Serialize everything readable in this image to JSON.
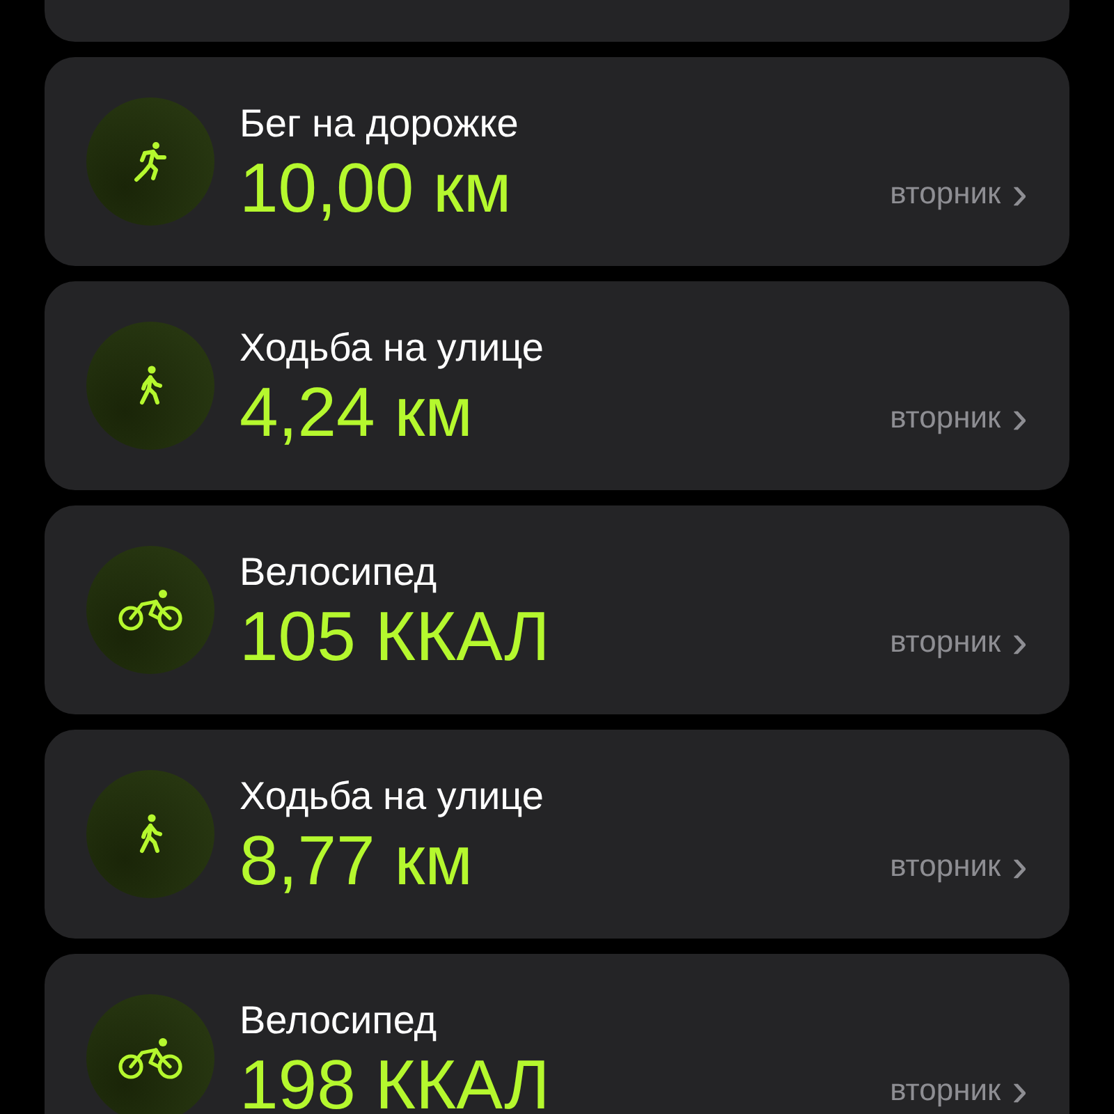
{
  "workouts": [
    {
      "kind": "run",
      "title": "Бег на дорожке",
      "value": "10,00 км",
      "day": "вторник",
      "chevron": "›"
    },
    {
      "kind": "walk",
      "title": "Ходьба на улице",
      "value": "4,24 км",
      "day": "вторник",
      "chevron": "›"
    },
    {
      "kind": "bike",
      "title": "Велосипед",
      "value": "105 ККАЛ",
      "day": "вторник",
      "chevron": "›"
    },
    {
      "kind": "walk",
      "title": "Ходьба на улице",
      "value": "8,77 км",
      "day": "вторник",
      "chevron": "›"
    },
    {
      "kind": "bike",
      "title": "Велосипед",
      "value": "198 ККАЛ",
      "day": "вторник",
      "chevron": "›"
    }
  ]
}
